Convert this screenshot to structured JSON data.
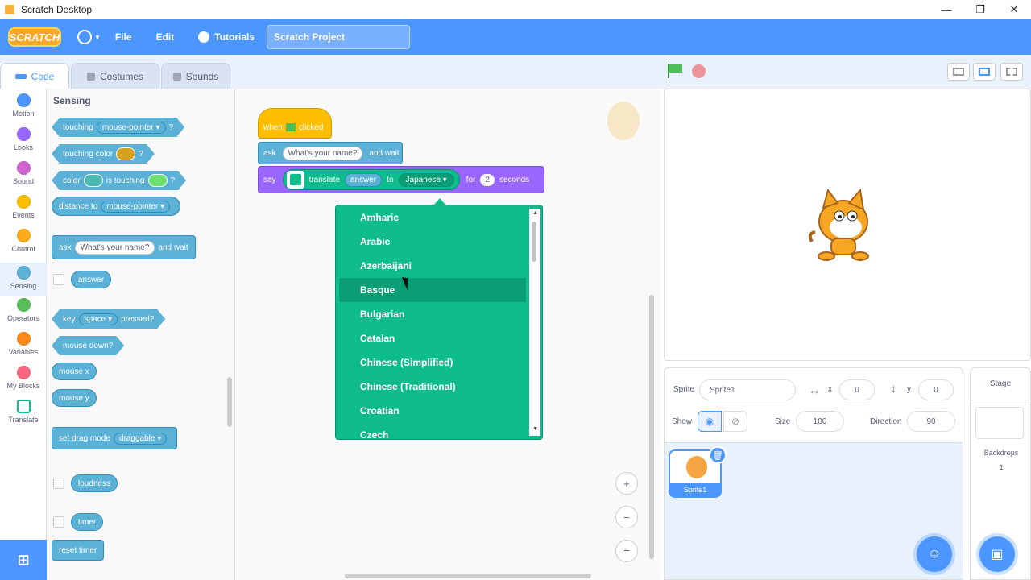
{
  "window": {
    "title": "Scratch Desktop",
    "minimize": "—",
    "maximize": "❐",
    "close": "✕"
  },
  "menubar": {
    "logo": "SCRATCH",
    "file": "File",
    "edit": "Edit",
    "tutorials": "Tutorials",
    "project_title": "Scratch Project"
  },
  "tabs": [
    {
      "label": "Code"
    },
    {
      "label": "Costumes"
    },
    {
      "label": "Sounds"
    }
  ],
  "categories": [
    {
      "label": "Motion",
      "color": "#4c97ff"
    },
    {
      "label": "Looks",
      "color": "#9966ff"
    },
    {
      "label": "Sound",
      "color": "#cf63cf"
    },
    {
      "label": "Events",
      "color": "#ffbf00"
    },
    {
      "label": "Control",
      "color": "#ffab19"
    },
    {
      "label": "Sensing",
      "color": "#5cb1d6"
    },
    {
      "label": "Operators",
      "color": "#59c059"
    },
    {
      "label": "Variables",
      "color": "#ff8c1a"
    },
    {
      "label": "My Blocks",
      "color": "#ff6680"
    },
    {
      "label": "Translate",
      "color": "#0fbd8c"
    }
  ],
  "palette": {
    "title": "Sensing",
    "touching": "touching",
    "mouse_pointer": "mouse-pointer",
    "question": "?",
    "touching_color": "touching color",
    "color": "color",
    "is_touching": "is touching",
    "distance_to": "distance to",
    "ask": "ask",
    "whats_your_name": "What's your name?",
    "and_wait": "and wait",
    "answer": "answer",
    "key": "key",
    "space": "space",
    "pressed": "pressed?",
    "mouse_down": "mouse down?",
    "mouse_x": "mouse x",
    "mouse_y": "mouse y",
    "set_drag_mode": "set drag mode",
    "draggable": "draggable",
    "loudness": "loudness",
    "timer": "timer",
    "reset_timer": "reset timer"
  },
  "script": {
    "when": "when",
    "clicked": "clicked",
    "ask": "ask",
    "ask_value": "What's your name?",
    "and_wait": "and wait",
    "say": "say",
    "translate": "translate",
    "answer": "answer",
    "to": "to",
    "language": "Japanese",
    "for": "for",
    "seconds_value": "2",
    "seconds": "seconds"
  },
  "dropdown": {
    "items": [
      "Amharic",
      "Arabic",
      "Azerbaijani",
      "Basque",
      "Bulgarian",
      "Catalan",
      "Chinese (Simplified)",
      "Chinese (Traditional)",
      "Croatian",
      "Czech"
    ],
    "hovered": "Basque"
  },
  "zoom": {
    "in": "+",
    "out": "−",
    "reset": "="
  },
  "sprite_info": {
    "sprite_label": "Sprite",
    "sprite_name": "Sprite1",
    "x_label": "x",
    "x_value": "0",
    "y_label": "y",
    "y_value": "0",
    "show_label": "Show",
    "size_label": "Size",
    "size_value": "100",
    "direction_label": "Direction",
    "direction_value": "90"
  },
  "sprite_list": [
    {
      "name": "Sprite1"
    }
  ],
  "stage_pane": {
    "title": "Stage",
    "backdrops_label": "Backdrops",
    "backdrops_count": "1"
  },
  "colors": {
    "menubar": "#4c97ff",
    "sensing": "#5cb1d6",
    "looks": "#9966ff",
    "events": "#ffbf00",
    "translate": "#0fbd8c"
  }
}
